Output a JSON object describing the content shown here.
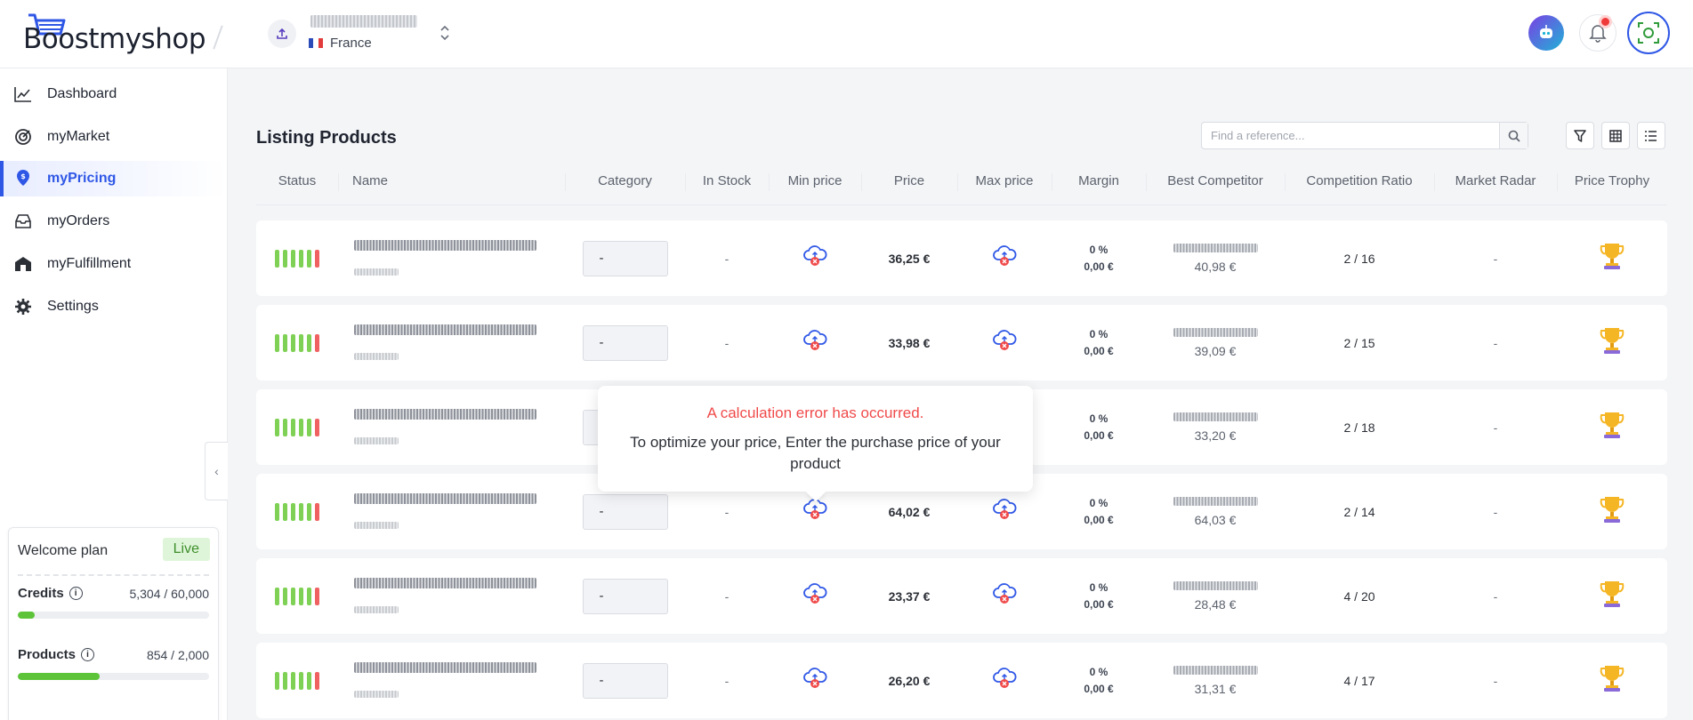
{
  "brand": {
    "logo_text": "Boostmyshop"
  },
  "header": {
    "shop_country": "France"
  },
  "sidebar": {
    "items": [
      {
        "label": "Dashboard",
        "icon": "chart-line-icon"
      },
      {
        "label": "myMarket",
        "icon": "market-radar-icon"
      },
      {
        "label": "myPricing",
        "icon": "pricing-pin-icon",
        "active": true
      },
      {
        "label": "myOrders",
        "icon": "inbox-icon"
      },
      {
        "label": "myFulfillment",
        "icon": "warehouse-icon"
      },
      {
        "label": "Settings",
        "icon": "gear-icon"
      }
    ]
  },
  "plan": {
    "title": "Welcome plan",
    "badge": "Live",
    "credits_label": "Credits",
    "credits_value": "5,304 / 60,000",
    "credits_fraction": 0.0884,
    "products_label": "Products",
    "products_value": "854 / 2,000",
    "products_fraction": 0.427
  },
  "main": {
    "title": "Listing Products",
    "search_placeholder": "Find a reference...",
    "columns": [
      "Status",
      "Name",
      "Category",
      "In Stock",
      "Min price",
      "Price",
      "Max price",
      "Margin",
      "Best Competitor",
      "Competition Ratio",
      "Market Radar",
      "Price Trophy"
    ],
    "rows": [
      {
        "category": "-",
        "in_stock": "-",
        "price": "36,25 €",
        "margin_pct": "0 %",
        "margin_amt": "0,00 €",
        "competitor_price": "40,98 €",
        "ratio": "2 / 16",
        "radar": "-"
      },
      {
        "category": "-",
        "in_stock": "-",
        "price": "33,98 €",
        "margin_pct": "0 %",
        "margin_amt": "0,00 €",
        "competitor_price": "39,09 €",
        "ratio": "2 / 15",
        "radar": "-"
      },
      {
        "category": "-",
        "in_stock": "-",
        "price": "",
        "margin_pct": "0 %",
        "margin_amt": "0,00 €",
        "competitor_price": "33,20 €",
        "ratio": "2 / 18",
        "radar": "-"
      },
      {
        "category": "-",
        "in_stock": "-",
        "price": "64,02 €",
        "margin_pct": "0 %",
        "margin_amt": "0,00 €",
        "competitor_price": "64,03 €",
        "ratio": "2 / 14",
        "radar": "-"
      },
      {
        "category": "-",
        "in_stock": "-",
        "price": "23,37 €",
        "margin_pct": "0 %",
        "margin_amt": "0,00 €",
        "competitor_price": "28,48 €",
        "ratio": "4 / 20",
        "radar": "-"
      },
      {
        "category": "-",
        "in_stock": "-",
        "price": "26,20 €",
        "margin_pct": "0 %",
        "margin_amt": "0,00 €",
        "competitor_price": "31,31 €",
        "ratio": "4 / 17",
        "radar": "-"
      }
    ]
  },
  "tooltip": {
    "title": "A calculation error has occurred.",
    "message": "To optimize your price, Enter the purchase price of your product"
  },
  "colors": {
    "accent": "#2f57e6",
    "status_green": "#7fd155",
    "status_red": "#f06262",
    "error": "#f04a4a"
  }
}
